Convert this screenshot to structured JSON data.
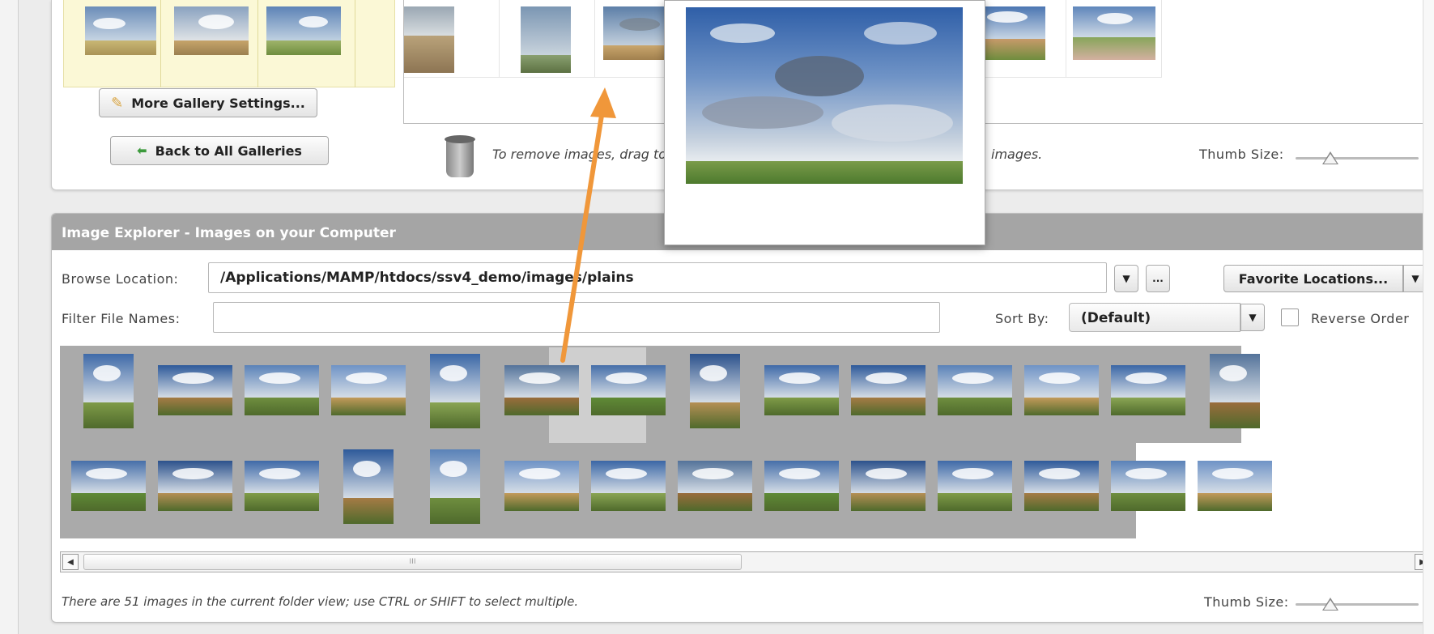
{
  "gallery": {
    "more_settings_label": "More Gallery Settings...",
    "back_label": "Back to All Galleries",
    "hint_left": "To remove images, drag to",
    "hint_right": "images.",
    "thumb_size_label": "Thumb Size:",
    "thumb_size_value": 0.25
  },
  "explorer": {
    "header": "Image Explorer - Images on your Computer",
    "browse_label": "Browse Location:",
    "browse_value": "/Applications/MAMP/htdocs/ssv4_demo/images/plains",
    "browse_more": "...",
    "favorites_label": "Favorite Locations...",
    "filter_label": "Filter File Names:",
    "filter_value": "",
    "sort_label": "Sort By:",
    "sort_value": "(Default)",
    "reverse_label": "Reverse Order",
    "reverse_checked": false,
    "status": "There are 51 images in the current folder view; use CTRL or SHIFT to select multiple.",
    "thumb_size_label": "Thumb Size:",
    "thumb_size_value": 0.25,
    "scroll_grip": "III"
  },
  "colors": {
    "accent_arrow": "#f0973a",
    "header_bg": "#a5a5a5",
    "yellow_area": "#fbf8d6"
  },
  "icons": {
    "pencil": "✎",
    "back_arrow": "⬅",
    "dropdown": "▼",
    "scroll_left": "◀",
    "scroll_right": "▶"
  }
}
